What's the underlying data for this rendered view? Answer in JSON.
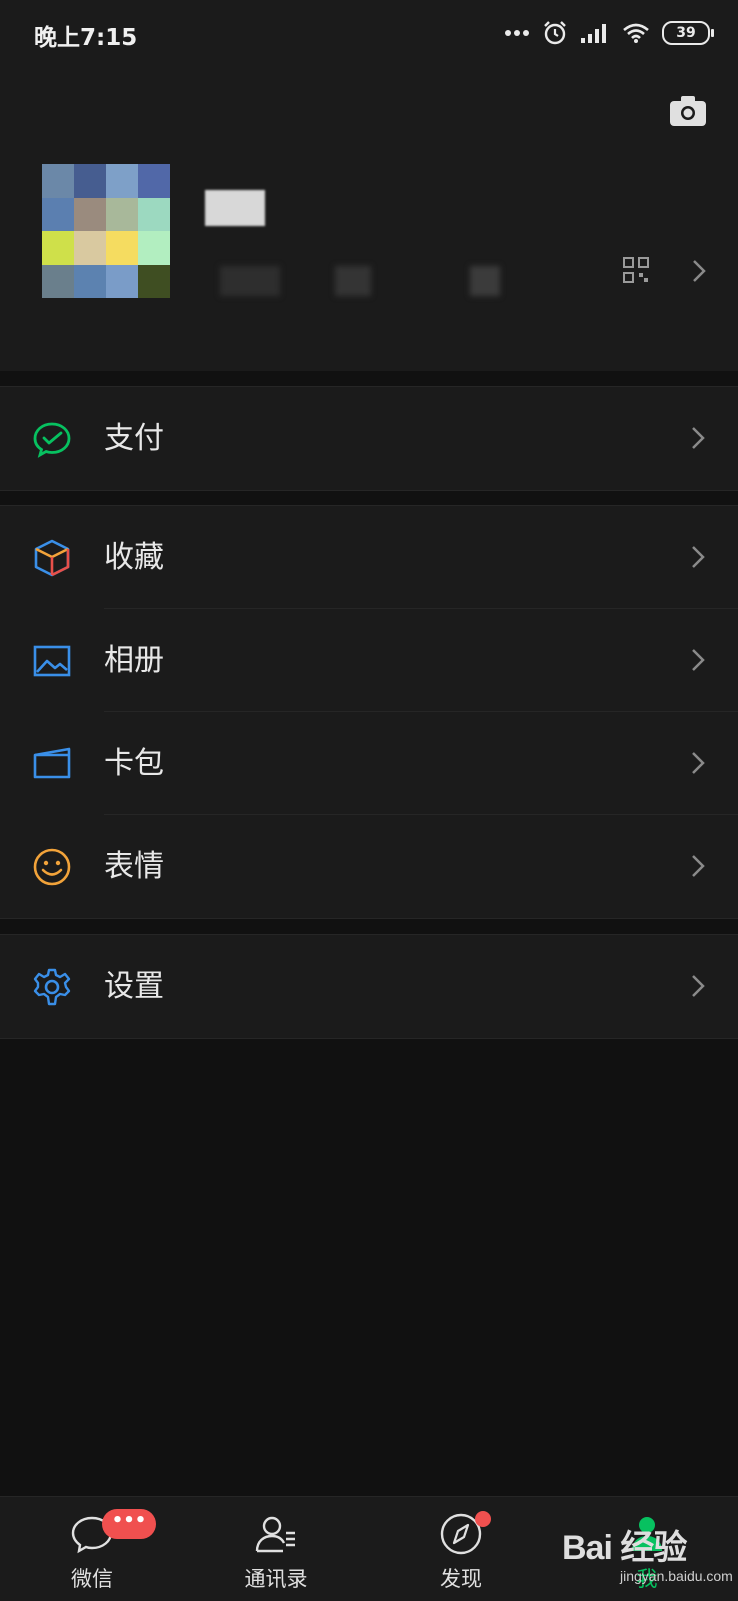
{
  "status_bar": {
    "time": "晚上7:15",
    "battery": "39"
  },
  "colors": {
    "accent_green": "#07c160",
    "badge_red": "#f0504f",
    "background": "#111111",
    "surface": "#1b1b1b"
  },
  "profile": {
    "camera_icon": "camera-icon",
    "qr_icon": "qr-code-icon"
  },
  "menu_groups": [
    [
      {
        "label": "支付",
        "icon": "pay-icon"
      }
    ],
    [
      {
        "label": "收藏",
        "icon": "favorites-cube-icon"
      },
      {
        "label": "相册",
        "icon": "album-icon"
      },
      {
        "label": "卡包",
        "icon": "card-wallet-icon"
      },
      {
        "label": "表情",
        "icon": "emoji-icon"
      }
    ],
    [
      {
        "label": "设置",
        "icon": "gear-icon"
      }
    ]
  ],
  "tabbar": {
    "tabs": [
      {
        "label": "微信",
        "icon": "chat-icon",
        "badge": "•••"
      },
      {
        "label": "通讯录",
        "icon": "contacts-icon"
      },
      {
        "label": "发现",
        "icon": "discover-compass-icon"
      },
      {
        "label": "我",
        "icon": "me-icon",
        "active": true
      }
    ]
  },
  "watermark": {
    "logo": "Bai 经验",
    "url": "jingyan.baidu.com"
  }
}
